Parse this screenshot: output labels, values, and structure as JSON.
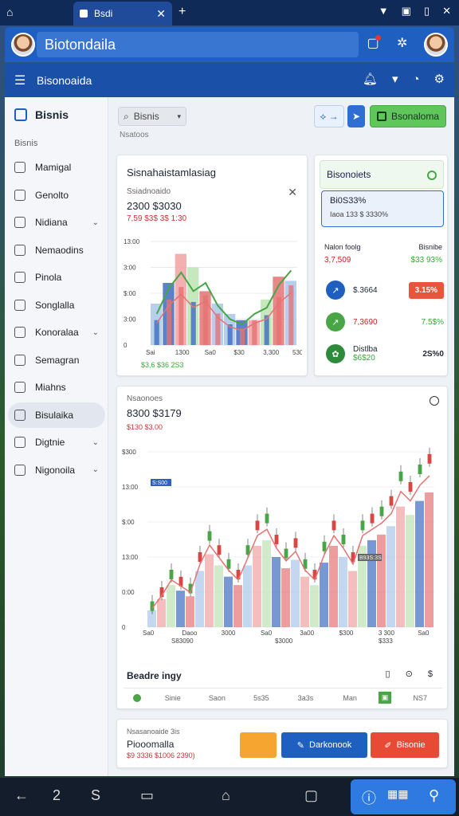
{
  "browser": {
    "tab": "Bsdi"
  },
  "app": {
    "title": "Biotondaila"
  },
  "nav": {
    "label": "Bisonoaida"
  },
  "sidebar": {
    "header": "Bisnis",
    "section": "Bisnis",
    "items": [
      {
        "label": "Mamigal",
        "chev": false
      },
      {
        "label": "Genolto",
        "chev": false
      },
      {
        "label": "Nidiana",
        "chev": true
      },
      {
        "label": "Nemaodins",
        "chev": false
      },
      {
        "label": "Pinola",
        "chev": false
      },
      {
        "label": "Songlalla",
        "chev": false
      },
      {
        "label": "Konoralaa",
        "chev": true
      },
      {
        "label": "Semagran",
        "chev": false
      },
      {
        "label": "Miahns",
        "chev": false
      },
      {
        "label": "Bisulaika",
        "chev": false
      },
      {
        "label": "Digtnie",
        "chev": true
      },
      {
        "label": "Nigonoila",
        "chev": true
      }
    ]
  },
  "toolbar": {
    "search": "Bisnis",
    "breadcrumb": "Nsatoos",
    "primary": "Bsonaloma"
  },
  "card1": {
    "title": "Sisnahaistamlasiag",
    "subtitle": "Ssiadnoaido",
    "value": "2300 $3030",
    "delta": "7,59 $3$ 3$ 1:30",
    "legend": "$3,6 $36 2S3",
    "yticks": [
      "13:00",
      "3:00",
      "$:00",
      "3:00",
      "0"
    ],
    "xticks": [
      "Sai",
      "1300",
      "Sa0",
      "$30",
      "3,300",
      "5300"
    ]
  },
  "card2": {
    "header": "Bisonoiets",
    "box_title": "Bi0S33%",
    "box_sub": "Iaoa  133 $ 3330%",
    "col1": "Nalon foolg",
    "col2": "Bisnibe",
    "row_val1": "3,7,509",
    "row_val2": "$33 93%",
    "rows": [
      {
        "label": "$.3664",
        "value": "3.15%"
      },
      {
        "label": "7,3690",
        "value": "7.5$%"
      },
      {
        "label": "Distlba",
        "label2": "$6$20",
        "value": "2S%0"
      }
    ]
  },
  "card3": {
    "subtitle": "Nsaonoes",
    "value": "8300 $3179",
    "delta": "$130 $3.00",
    "yticks": [
      "$300",
      "13:00",
      "$:00",
      "13:00",
      "0:00",
      "0"
    ],
    "badge1": "S:S00",
    "badge2": "B93S:3S",
    "xticks": [
      "Sa0",
      "Daoo",
      "3000",
      "Sa0",
      "3a00",
      "$300",
      "3 300",
      "Sa0"
    ],
    "xsub": [
      "S83090",
      "$3000",
      "$333"
    ],
    "section": "Beadre ingy",
    "tabs": [
      "Sinie",
      "Saon",
      "5s35",
      "3a3s",
      "Man",
      "",
      "NS7"
    ]
  },
  "card4": {
    "subtitle": "Nsasanoaide 3is",
    "value": "Piooomalla",
    "delta": "$9 3336 $1006 2390)",
    "btn_dark": "Darkonook",
    "btn_red": "Bisonie"
  },
  "colors": {
    "blue": "#3d6cc0",
    "red": "#e57373",
    "green": "#4aa547",
    "lightblue": "#a9c7ea",
    "lightgreen": "#bde3b3",
    "pink": "#f0a2a2"
  },
  "chart_data": [
    {
      "type": "bar",
      "series": [
        {
          "name": "",
          "values": [
            40,
            60,
            88,
            75,
            52,
            40,
            30,
            24,
            24,
            44,
            66,
            62
          ]
        },
        {
          "name": "",
          "values": [
            30,
            55,
            70,
            52,
            60,
            38,
            25,
            20,
            30,
            36,
            58,
            72
          ]
        }
      ]
    },
    {
      "type": "bar",
      "series": [
        {
          "name": "",
          "values": [
            12,
            20,
            30,
            26,
            22,
            40,
            52,
            44,
            36,
            30,
            44,
            58,
            62,
            50,
            42,
            48,
            36,
            30,
            46,
            58,
            50,
            40,
            58,
            62,
            66,
            72,
            86,
            80,
            90,
            96
          ]
        }
      ]
    }
  ]
}
